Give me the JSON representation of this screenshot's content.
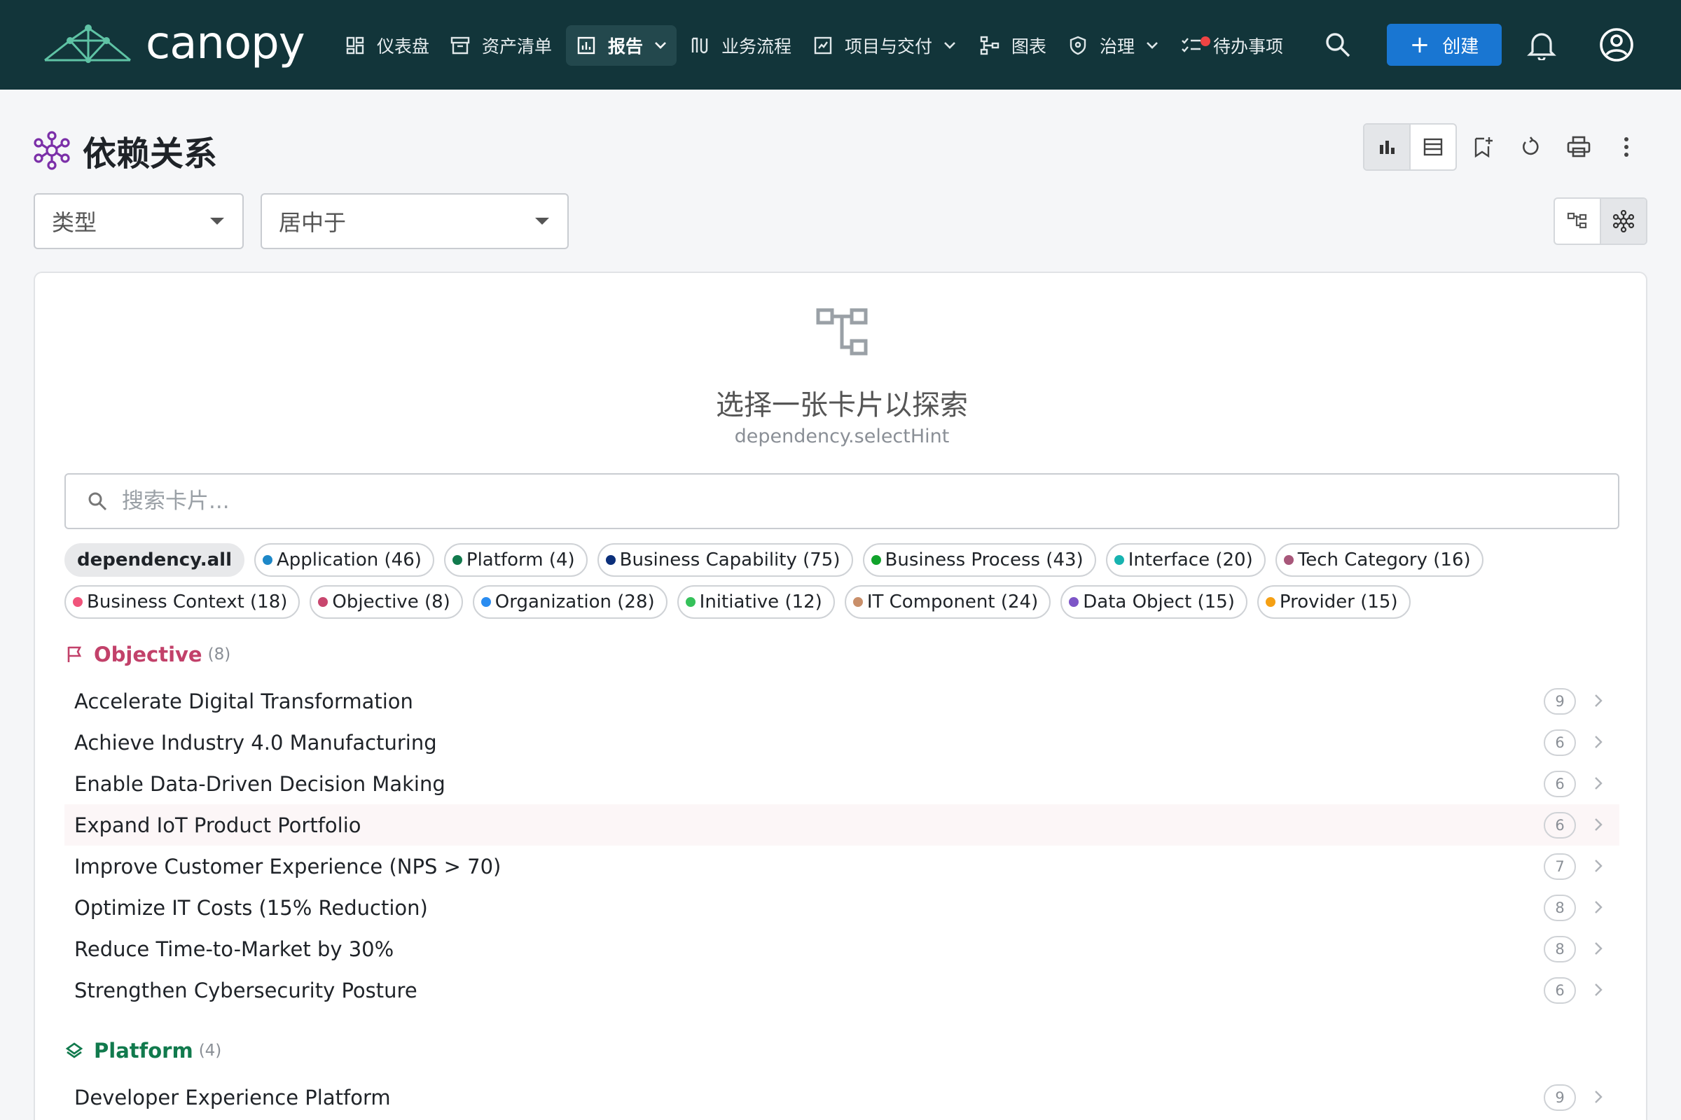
{
  "app": {
    "name": "canopy"
  },
  "nav": {
    "items": [
      {
        "label": "仪表盘",
        "icon": "dashboard-icon"
      },
      {
        "label": "资产清单",
        "icon": "archive-icon"
      },
      {
        "label": "报告",
        "icon": "report-icon",
        "active": true,
        "has_menu": true
      },
      {
        "label": "业务流程",
        "icon": "process-icon"
      },
      {
        "label": "项目与交付",
        "icon": "project-icon",
        "has_menu": true
      },
      {
        "label": "图表",
        "icon": "diagram-icon"
      },
      {
        "label": "治理",
        "icon": "governance-icon",
        "has_menu": true
      },
      {
        "label": "待办事项",
        "icon": "todo-icon",
        "has_notification": true
      }
    ],
    "create_label": "创建"
  },
  "page": {
    "title": "依赖关系",
    "filters": {
      "type_placeholder": "类型",
      "center_placeholder": "居中于"
    }
  },
  "empty_state": {
    "title": "选择一张卡片以探索",
    "hint": "dependency.selectHint"
  },
  "search": {
    "placeholder": "搜索卡片..."
  },
  "chips": {
    "all": "dependency.all",
    "row1": [
      {
        "label": "Application (46)",
        "color": "#1e88c8"
      },
      {
        "label": "Platform (4)",
        "color": "#117a4d"
      },
      {
        "label": "Business Capability (75)",
        "color": "#0b2f7a"
      },
      {
        "label": "Business Process (43)",
        "color": "#11a32b"
      },
      {
        "label": "Interface (20)",
        "color": "#17b3b0"
      },
      {
        "label": "Tech Category (16)",
        "color": "#a8577a"
      }
    ],
    "row2": [
      {
        "label": "Business Context (18)",
        "color": "#f0547b"
      },
      {
        "label": "Objective (8)",
        "color": "#c8466e"
      },
      {
        "label": "Organization (28)",
        "color": "#2a8cf0"
      },
      {
        "label": "Initiative (12)",
        "color": "#35c15a"
      },
      {
        "label": "IT Component (24)",
        "color": "#c98f6a"
      },
      {
        "label": "Data Object (15)",
        "color": "#7d55c7"
      },
      {
        "label": "Provider (15)",
        "color": "#f5a014"
      }
    ]
  },
  "sections": {
    "objective": {
      "title": "Objective",
      "count": "(8)",
      "color": "#c2416a",
      "items": [
        {
          "name": "Accelerate Digital Transformation",
          "count": "9"
        },
        {
          "name": "Achieve Industry 4.0 Manufacturing",
          "count": "6"
        },
        {
          "name": "Enable Data-Driven Decision Making",
          "count": "6"
        },
        {
          "name": "Expand IoT Product Portfolio",
          "count": "6"
        },
        {
          "name": "Improve Customer Experience (NPS > 70)",
          "count": "7"
        },
        {
          "name": "Optimize IT Costs (15% Reduction)",
          "count": "8"
        },
        {
          "name": "Reduce Time-to-Market by 30%",
          "count": "8"
        },
        {
          "name": "Strengthen Cybersecurity Posture",
          "count": "6"
        }
      ]
    },
    "platform": {
      "title": "Platform",
      "count": "(4)",
      "color": "#117a4d",
      "items": [
        {
          "name": "Developer Experience Platform",
          "count": "9"
        }
      ]
    }
  }
}
